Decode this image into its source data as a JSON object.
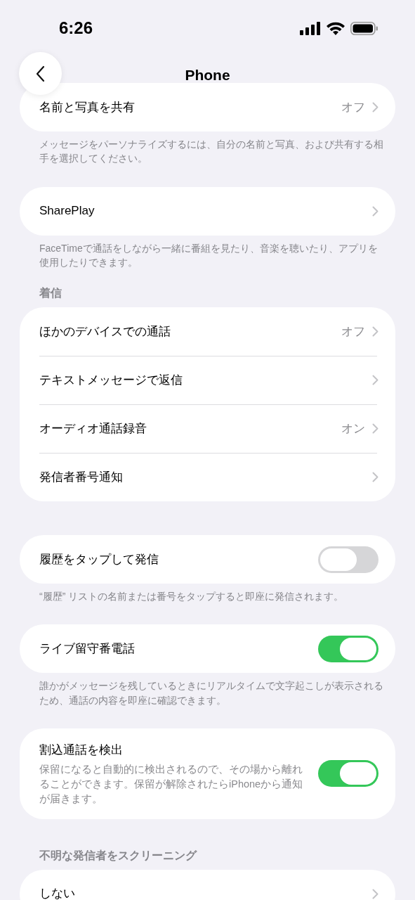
{
  "status_bar": {
    "time": "6:26"
  },
  "nav": {
    "title": "Phone"
  },
  "sections": [
    {
      "rows": [
        {
          "kind": "link",
          "label": "名前と写真を共有",
          "value": "オフ"
        }
      ],
      "footer": "メッセージをパーソナライズするには、自分の名前と写真、および共有する相手を選択してください。"
    },
    {
      "rows": [
        {
          "kind": "link",
          "label": "SharePlay"
        }
      ],
      "footer": "FaceTimeで通話をしながら一緒に番組を見たり、音楽を聴いたり、アプリを使用したりできます。"
    },
    {
      "header": "着信",
      "rows": [
        {
          "kind": "link",
          "label": "ほかのデバイスでの通話",
          "value": "オフ"
        },
        {
          "kind": "link",
          "label": "テキストメッセージで返信"
        },
        {
          "kind": "link",
          "label": "オーディオ通話録音",
          "value": "オン"
        },
        {
          "kind": "link",
          "label": "発信者番号通知"
        }
      ]
    },
    {
      "rows": [
        {
          "kind": "toggle",
          "label": "履歴をタップして発信",
          "on": false
        }
      ],
      "footer": "“履歴” リストの名前または番号をタップすると即座に発信されます。"
    },
    {
      "rows": [
        {
          "kind": "toggle",
          "label": "ライブ留守番電話",
          "on": true
        }
      ],
      "footer": "誰かがメッセージを残しているときにリアルタイムで文字起こしが表示されるため、通話の内容を即座に確認できます。"
    },
    {
      "rows": [
        {
          "kind": "toggle",
          "label": "割込通話を検出",
          "subtitle": "保留になると自動的に検出されるので、その場から離れることができます。保留が解除されたらiPhoneから通知が届きます。",
          "on": true
        }
      ]
    },
    {
      "header": "不明な発信者をスクリーニング",
      "rows": [
        {
          "kind": "link",
          "label": "しない"
        }
      ]
    }
  ]
}
